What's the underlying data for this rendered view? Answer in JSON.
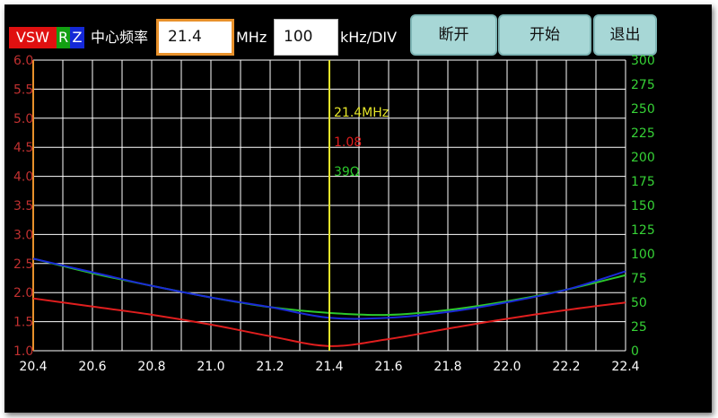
{
  "toolbar": {
    "legend_vsw": "VSW",
    "legend_r": "R",
    "legend_z": "Z",
    "center_freq_label": "中心频率",
    "center_freq_value": "21.4",
    "mhz_unit": "MHz",
    "span_value": "100",
    "span_unit": "kHz/DIV",
    "disconnect_label": "断开",
    "start_label": "开始",
    "exit_label": "退出"
  },
  "colors": {
    "vswr": "#e01e1e",
    "r": "#2cc82c",
    "z": "#1a2ad8",
    "cursor": "#e8e82a",
    "grid": "#ffffff",
    "left_axis": "#c03030",
    "right_axis": "#36d236",
    "button_bg": "#a7d7d6",
    "active_input_border": "#e8912b"
  },
  "cursor": {
    "frequency_text": "21.4MHz",
    "vswr_text": "1.08",
    "impedance_text": "39Ω"
  },
  "chart_data": {
    "type": "line",
    "xlim": [
      20.4,
      22.4
    ],
    "ylim_left": [
      1.0,
      6.0
    ],
    "ylim_right": [
      0,
      300
    ],
    "grid": true,
    "x_ticks": [
      "20.4",
      "20.6",
      "20.8",
      "21.0",
      "21.2",
      "21.4",
      "21.6",
      "21.8",
      "22.0",
      "22.2",
      "22.4"
    ],
    "y_left_ticks": [
      "1.0",
      "1.5",
      "2.0",
      "2.5",
      "3.0",
      "3.5",
      "4.0",
      "4.5",
      "5.0",
      "5.5",
      "6.0"
    ],
    "y_right_ticks": [
      "0",
      "25",
      "50",
      "75",
      "100",
      "125",
      "150",
      "175",
      "200",
      "225",
      "250",
      "275",
      "300"
    ],
    "cursor_x": 21.4,
    "series": [
      {
        "key": "vswr",
        "axis": "left",
        "x": [
          20.4,
          20.6,
          20.8,
          21.0,
          21.2,
          21.4,
          21.6,
          21.8,
          22.0,
          22.2,
          22.4
        ],
        "y": [
          1.9,
          1.76,
          1.62,
          1.45,
          1.25,
          1.08,
          1.2,
          1.38,
          1.55,
          1.7,
          1.83
        ]
      },
      {
        "key": "r",
        "axis": "right",
        "x": [
          20.4,
          20.6,
          20.8,
          21.0,
          21.2,
          21.4,
          21.6,
          21.8,
          22.0,
          22.2,
          22.4
        ],
        "y": [
          95,
          80,
          67,
          55,
          45,
          39,
          37,
          42,
          51,
          63,
          78
        ]
      },
      {
        "key": "z",
        "axis": "right",
        "x": [
          20.4,
          20.6,
          20.8,
          21.0,
          21.2,
          21.4,
          21.6,
          21.8,
          22.0,
          22.2,
          22.4
        ],
        "y": [
          95,
          81,
          67,
          55,
          45,
          34,
          34,
          40,
          50,
          63,
          82
        ]
      }
    ]
  }
}
